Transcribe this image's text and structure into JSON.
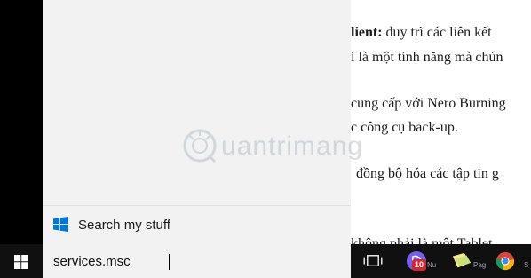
{
  "document": {
    "line1_bold": "lient:",
    "line1_rest": " duy trì các liên kết",
    "line2": "i là một tính năng mà chún",
    "line3": "cung cấp với Nero Burning",
    "line4": "c công cụ back-up.",
    "line5": "đồng bộ hóa các tập tin g",
    "line6": "không phải là một Tablet"
  },
  "watermark": {
    "text": "uantrimang",
    "logo_icon": "quantrimang-logo-icon"
  },
  "start_menu": {
    "search_item_label": "Search my stuff",
    "search_item_icon": "windows-logo-icon"
  },
  "taskbar": {
    "search_value": "services.msc",
    "viber_badge": "10",
    "viber_label": "Nu",
    "sticky_label": "Pag",
    "partial_label": "S",
    "colors": {
      "taskbar_bg": "#101010",
      "windows_blue": "#0078d7"
    }
  }
}
